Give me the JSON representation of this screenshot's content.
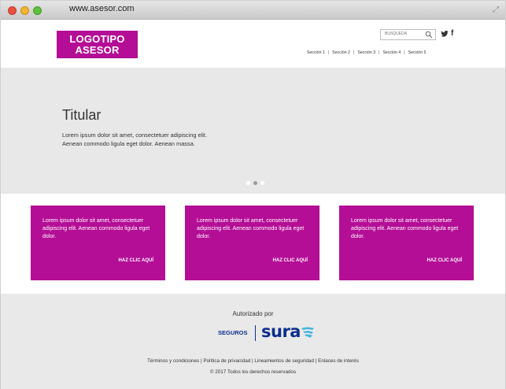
{
  "browser": {
    "url": "www.asesor.com"
  },
  "header": {
    "logo_line1": "LOGOTIPO",
    "logo_line2": "ASESOR",
    "search_placeholder": "BÚSQUEDA",
    "nav": [
      "Sección 1",
      "Sección 2",
      "Sección 3",
      "Sección 4",
      "Sección 5"
    ],
    "nav_separator": "|"
  },
  "hero": {
    "title": "Titular",
    "text": "Lorem ipsum dolor sit amet, consectetuer adipiscing elit. Aenean commodo ligula eget dolor. Aenean massa.",
    "carousel_active_index": 1,
    "carousel_count": 3
  },
  "cards": [
    {
      "text": "Lorem ipsum dolor sit amet, consectetuer adipiscing elit. Aenean commodo ligula eget dolor.",
      "link": "HAZ CLIC AQUÍ"
    },
    {
      "text": "Lorem ipsum dolor sit amet, consectetuer adipiscing elit. Aenean commodo ligula eget dolor.",
      "link": "HAZ CLIC AQUÍ"
    },
    {
      "text": "Lorem ipsum dolor sit amet, consectetuer adipiscing elit. Aenean commodo ligula eget dolor.",
      "link": "HAZ CLIC AQUÍ"
    }
  ],
  "footer": {
    "authorized_by": "Autorizado por",
    "brand_seguros": "SEGUROS",
    "brand_sura": "sura",
    "links": [
      "Términos y condiciones",
      "Política de privacidad",
      "Lineamientos de seguridad",
      "Enlaces de interés"
    ],
    "links_separator": "|",
    "copyright": "© 2017 Todos los derechos reservados"
  },
  "colors": {
    "accent": "#b40e96",
    "brand_blue": "#0d2f8c",
    "brand_teal": "#3fb6e0",
    "hero_bg": "#e8e8e8",
    "footer_bg": "#e9e9e9"
  }
}
